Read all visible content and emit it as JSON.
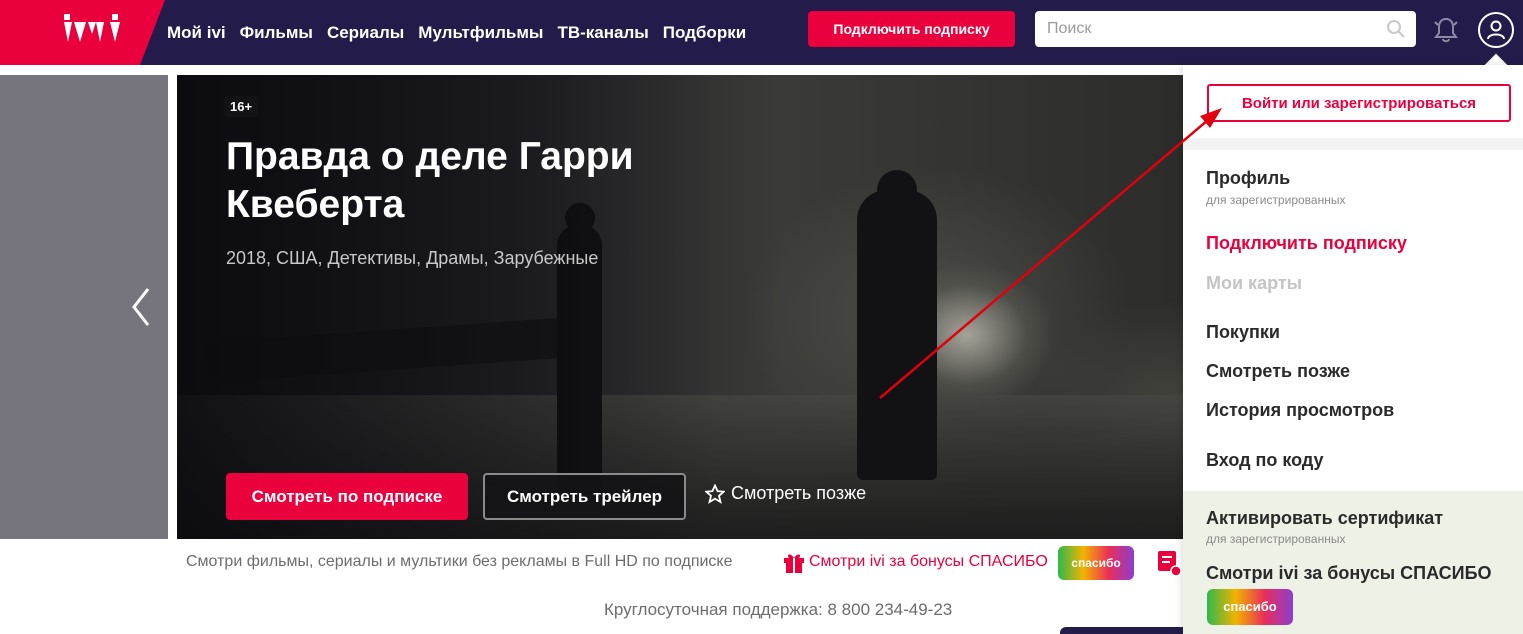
{
  "header": {
    "logo_text": "ivi",
    "nav": [
      "Мой ivi",
      "Фильмы",
      "Сериалы",
      "Мультфильмы",
      "ТВ-каналы",
      "Подборки"
    ],
    "subscribe_label": "Подключить подписку",
    "search_placeholder": "Поиск",
    "icons": {
      "search": "search-icon",
      "bell": "bell-icon",
      "user": "user-icon"
    }
  },
  "hero": {
    "age_rating": "16+",
    "title": "Правда о деле Гарри Квеберта",
    "meta": "2018, США, Детективы, Драмы, Зарубежные",
    "watch_button": "Смотреть по подписке",
    "trailer_button": "Смотреть трейлер",
    "watch_later": "Смотреть позже",
    "watch_later_icon": "star-icon",
    "prev_icon": "chevron-left-icon"
  },
  "promo": {
    "text": "Смотри фильмы, сериалы и мультики без рекламы в Full HD по подписке",
    "bonus_link": "Смотри ivi за бонусы СПАСИБО",
    "spasibo_badge": "спасибо",
    "gift_icon": "gift-icon"
  },
  "support": "Круглосуточная поддержка: 8 800 234-49-23",
  "dropdown": {
    "login_button": "Войти или зарегистрироваться",
    "items": [
      {
        "label": "Профиль",
        "sub": "для зарегистрированных"
      },
      {
        "label": "Подключить подписку"
      },
      {
        "label": "Мои карты"
      },
      {
        "label": "Покупки"
      },
      {
        "label": "Смотреть позже"
      },
      {
        "label": "История просмотров"
      },
      {
        "label": "Вход по коду"
      }
    ],
    "activate": {
      "label": "Активировать сертификат",
      "sub": "для зарегистрированных"
    },
    "bonus": {
      "label": "Смотри ivi за бонусы СПАСИБО",
      "badge": "спасибо"
    }
  },
  "colors": {
    "brand": "#ea003d",
    "header_bg": "#231c4b",
    "annotation_arrow": "#e0000f"
  }
}
